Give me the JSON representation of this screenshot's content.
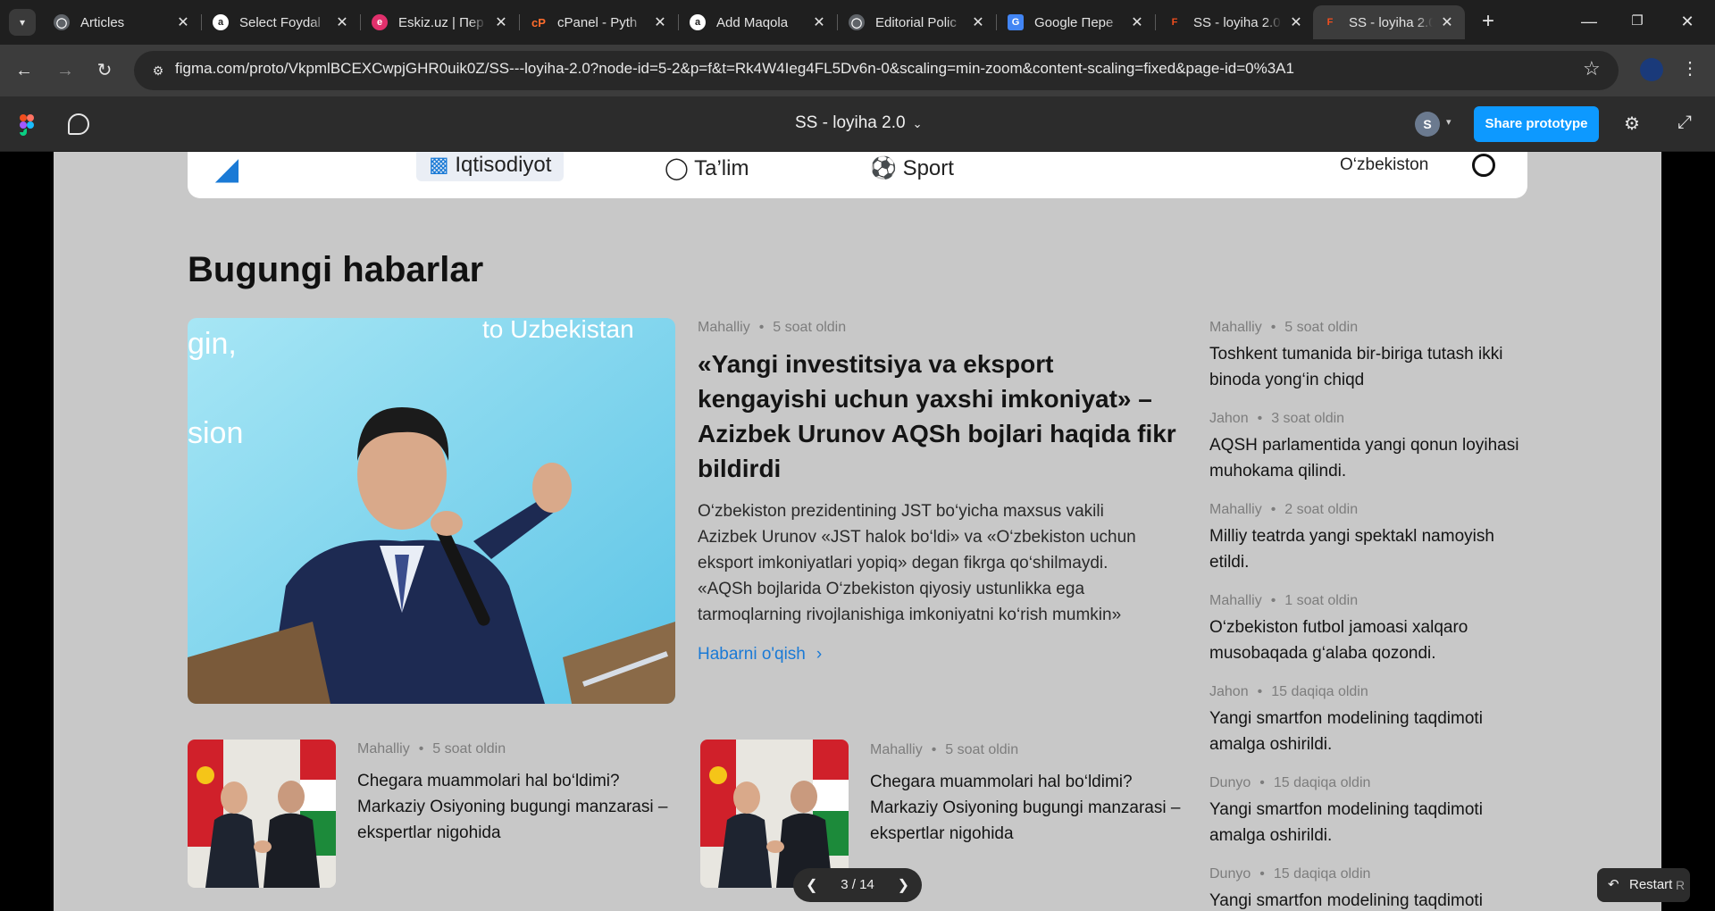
{
  "browser": {
    "tabs": [
      {
        "title": "Articles",
        "fav": "globe-icon",
        "fav_color": "#5f6368",
        "fav_glyph": ""
      },
      {
        "title": "Select Foydal",
        "fav": "a-icon",
        "fav_color": "#ffffff",
        "fav_glyph": "a"
      },
      {
        "title": "Eskiz.uz | Пер",
        "fav": "eskiz-icon",
        "fav_color": "#e1306c",
        "fav_glyph": "e"
      },
      {
        "title": "cPanel - Pyth",
        "fav": "cpanel-icon",
        "fav_color": "#ff6c2c",
        "fav_glyph": "cP"
      },
      {
        "title": "Add Maqola",
        "fav": "a-icon",
        "fav_color": "#ffffff",
        "fav_glyph": "a"
      },
      {
        "title": "Editorial Polic",
        "fav": "globe-icon",
        "fav_color": "#5f6368",
        "fav_glyph": ""
      },
      {
        "title": "Google Пере",
        "fav": "google-translate-icon",
        "fav_color": "#4285f4",
        "fav_glyph": "G"
      },
      {
        "title": "SS - loyiha 2.0",
        "fav": "figma-icon",
        "fav_color": "#f24e1e",
        "fav_glyph": "F"
      },
      {
        "title": "SS - loyiha 2.0",
        "fav": "figma-icon",
        "fav_color": "#f24e1e",
        "fav_glyph": "F"
      }
    ],
    "url": "figma.com/proto/VkpmlBCEXCwpjGHR0uik0Z/SS---loyiha-2.0?node-id=5-2&p=f&t=Rk4W4Ieg4FL5Dv6n-0&scaling=min-zoom&content-scaling=fixed&page-id=0%3A1"
  },
  "figma": {
    "file_title": "SS - loyiha 2.0",
    "avatar_initial": "S",
    "share_label": "Share prototype",
    "page_counter": "3 / 14",
    "restart_label": "Restart",
    "restart_key": "R"
  },
  "site": {
    "nav": [
      {
        "label": "Iqtisodiyot",
        "icon": "chart-icon"
      },
      {
        "label": "Ta’lim",
        "icon": "graduation-icon"
      },
      {
        "label": "Sport",
        "icon": "ball-icon"
      }
    ],
    "region": "O‘zbekiston",
    "section_title": "Bugungi habarlar",
    "hero": {
      "category": "Mahalliy",
      "time": "5 soat oldin",
      "title": "«Yangi investitsiya va eksport kengayishi uchun yaxshi imkoniyat» – Azizbek Urunov AQSh bojlari haqida fikr bildirdi",
      "description": "O‘zbekiston prezidentining JST bo‘yicha maxsus vakili Azizbek Urunov «JST halok bo‘ldi» va «O‘zbekiston uchun eksport imkoniyatlari yopiq» degan fikrga qo‘shilmaydi. «AQSh bojlarida O‘zbekiston qiyosiy ustunlikka ega tarmoqlarning rivojlanishiga imkoniyatni ko‘rish mumkin»",
      "read_more": "Habarni o'qish",
      "image_text_1": "to Uzbekistan",
      "image_text_2": "gin,",
      "image_text_3": "sion"
    },
    "cards": [
      {
        "category": "Mahalliy",
        "time": "5 soat oldin",
        "title": "Chegara muammolari hal bo‘ldimi? Markaziy Osiyoning bugungi manzarasi – ekspertlar nigohida"
      },
      {
        "category": "Mahalliy",
        "time": "5 soat oldin",
        "title": "Chegara muammolari hal bo‘ldimi? Markaziy Osiyoning bugungi manzarasi – ekspertlar nigohida"
      }
    ],
    "sidebar": [
      {
        "category": "Mahalliy",
        "time": "5 soat oldin",
        "title": "Toshkent tumanida bir-biriga tutash ikki binoda yong‘in chiqd"
      },
      {
        "category": "Jahon",
        "time": "3 soat oldin",
        "title": "AQSH parlamentida yangi qonun loyihasi muhokama qilindi."
      },
      {
        "category": "Mahalliy",
        "time": "2 soat oldin",
        "title": "Milliy teatrda yangi spektakl namoyish etildi."
      },
      {
        "category": "Mahalliy",
        "time": "1 soat oldin",
        "title": "O‘zbekiston futbol jamoasi xalqaro musobaqada g‘alaba qozondi."
      },
      {
        "category": "Jahon",
        "time": "15 daqiqa oldin",
        "title": "Yangi smartfon modelining taqdimoti amalga oshirildi."
      },
      {
        "category": "Dunyo",
        "time": "15 daqiqa oldin",
        "title": "Yangi smartfon modelining taqdimoti amalga oshirildi."
      },
      {
        "category": "Dunyo",
        "time": "15 daqiqa oldin",
        "title": "Yangi smartfon modelining taqdimoti"
      }
    ]
  },
  "colors": {
    "accent": "#0d99ff",
    "link": "#1a7ad6",
    "frame_bg": "#c8c8c8"
  }
}
